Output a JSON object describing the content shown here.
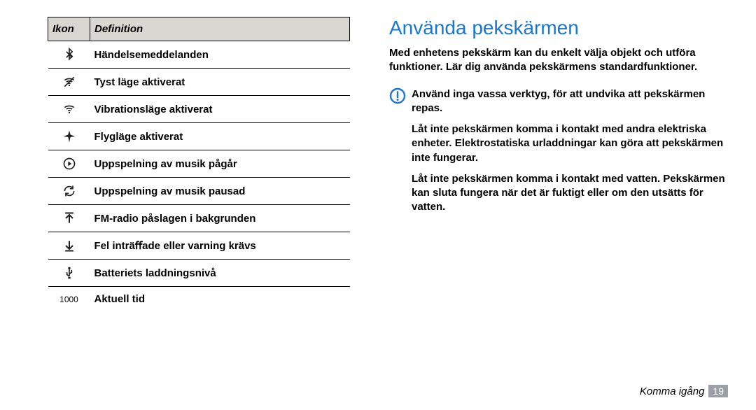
{
  "table": {
    "head_icon": "Ikon",
    "head_def": "Definition",
    "rows": [
      {
        "icon": "bluetooth",
        "def": "Händelsemeddelanden"
      },
      {
        "icon": "wifi-mute",
        "def": "Tyst läge aktiverat"
      },
      {
        "icon": "wifi",
        "def": "Vibrationsläge aktiverat"
      },
      {
        "icon": "airplane",
        "def": "Flygläge aktiverat"
      },
      {
        "icon": "play",
        "def": "Uppspelning av musik pågår"
      },
      {
        "icon": "sync",
        "def": "Uppspelning av musik pausad"
      },
      {
        "icon": "arrow-up",
        "def": "FM-radio påslagen i bakgrunden"
      },
      {
        "icon": "arrow-down",
        "def": "Fel inträﬀade eller varning krävs"
      },
      {
        "icon": "usb",
        "def": "Batteriets laddningsnivå"
      },
      {
        "icon": "time",
        "def": "Aktuell tid"
      }
    ],
    "time_label": "1000"
  },
  "right": {
    "heading": "Använda pekskärmen",
    "intro": "Med enhetens pekskärm kan du enkelt välja objekt och utföra funktioner. Lär dig använda pekskärmens standardfunktioner.",
    "warnings": [
      "Använd inga vassa verktyg, för att undvika att pekskärmen repas.",
      "Låt inte pekskärmen komma i kontakt med andra elektriska enheter. Elektrostatiska urladdningar kan göra att pekskärmen inte fungerar.",
      "Låt inte pekskärmen komma i kontakt med vatten. Pekskärmen kan sluta fungera när det är fuktigt eller om den utsätts för vatten."
    ]
  },
  "footer": {
    "text": "Komma igång",
    "page": "19"
  }
}
